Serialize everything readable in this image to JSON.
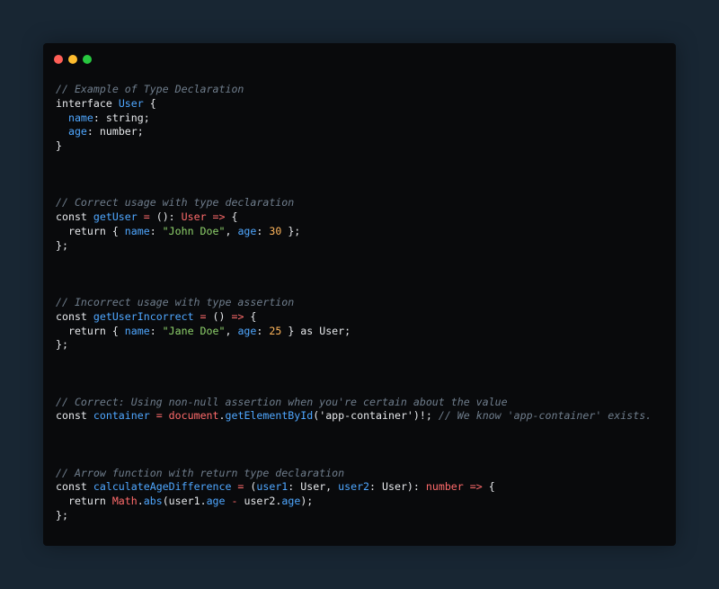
{
  "window": {
    "controls": [
      {
        "name": "close",
        "color": "#ff5f57"
      },
      {
        "name": "minimize",
        "color": "#febc2e"
      },
      {
        "name": "maximize",
        "color": "#28c840"
      }
    ]
  },
  "colors": {
    "page_background": "#182633",
    "editor_background": "#090a0c",
    "comment": "#6f7d8c",
    "type": "#4fa7ff",
    "operator": "#ff6b6b",
    "string": "#8ed16b",
    "number": "#ffb65c",
    "text": "#e6e8eb"
  },
  "code_lines": [
    [
      {
        "t": "// Example of Type Declaration",
        "c": "comment"
      }
    ],
    [
      {
        "t": "interface ",
        "c": "keyword"
      },
      {
        "t": "User",
        "c": "type"
      },
      {
        "t": " {",
        "c": "plain"
      }
    ],
    [
      {
        "t": "  ",
        "c": "plain"
      },
      {
        "t": "name",
        "c": "prop"
      },
      {
        "t": ": string;",
        "c": "plain"
      }
    ],
    [
      {
        "t": "  ",
        "c": "plain"
      },
      {
        "t": "age",
        "c": "prop"
      },
      {
        "t": ": number;",
        "c": "plain"
      }
    ],
    [
      {
        "t": "}",
        "c": "plain"
      }
    ],
    [],
    [],
    [],
    [
      {
        "t": "// Correct usage with type declaration",
        "c": "comment"
      }
    ],
    [
      {
        "t": "const ",
        "c": "keyword"
      },
      {
        "t": "getUser",
        "c": "func"
      },
      {
        "t": " = ",
        "c": "op"
      },
      {
        "t": "(): ",
        "c": "plain"
      },
      {
        "t": "User",
        "c": "op"
      },
      {
        "t": " => ",
        "c": "op"
      },
      {
        "t": "{",
        "c": "plain"
      }
    ],
    [
      {
        "t": "  return { ",
        "c": "plain"
      },
      {
        "t": "name",
        "c": "prop"
      },
      {
        "t": ": ",
        "c": "plain"
      },
      {
        "t": "\"John Doe\"",
        "c": "str"
      },
      {
        "t": ", ",
        "c": "plain"
      },
      {
        "t": "age",
        "c": "prop"
      },
      {
        "t": ": ",
        "c": "plain"
      },
      {
        "t": "30",
        "c": "num"
      },
      {
        "t": " };",
        "c": "plain"
      }
    ],
    [
      {
        "t": "};",
        "c": "plain"
      }
    ],
    [],
    [],
    [],
    [
      {
        "t": "// Incorrect usage with type assertion",
        "c": "comment"
      }
    ],
    [
      {
        "t": "const ",
        "c": "keyword"
      },
      {
        "t": "getUserIncorrect",
        "c": "func"
      },
      {
        "t": " = ",
        "c": "op"
      },
      {
        "t": "() ",
        "c": "plain"
      },
      {
        "t": "=>",
        "c": "op"
      },
      {
        "t": " {",
        "c": "plain"
      }
    ],
    [
      {
        "t": "  return { ",
        "c": "plain"
      },
      {
        "t": "name",
        "c": "prop"
      },
      {
        "t": ": ",
        "c": "plain"
      },
      {
        "t": "\"Jane Doe\"",
        "c": "str"
      },
      {
        "t": ", ",
        "c": "plain"
      },
      {
        "t": "age",
        "c": "prop"
      },
      {
        "t": ": ",
        "c": "plain"
      },
      {
        "t": "25",
        "c": "num"
      },
      {
        "t": " } as User;",
        "c": "plain"
      }
    ],
    [
      {
        "t": "};",
        "c": "plain"
      }
    ],
    [],
    [],
    [],
    [
      {
        "t": "// Correct: Using non-null assertion when you're certain about the value",
        "c": "comment"
      }
    ],
    [
      {
        "t": "const ",
        "c": "keyword"
      },
      {
        "t": "container",
        "c": "func"
      },
      {
        "t": " = ",
        "c": "op"
      },
      {
        "t": "document",
        "c": "op"
      },
      {
        "t": ".",
        "c": "plain"
      },
      {
        "t": "getElementById",
        "c": "func"
      },
      {
        "t": "('app-container')!; ",
        "c": "plain"
      },
      {
        "t": "// We know 'app-container' exists.",
        "c": "comment"
      }
    ],
    [],
    [],
    [],
    [
      {
        "t": "// Arrow function with return type declaration",
        "c": "comment"
      }
    ],
    [
      {
        "t": "const ",
        "c": "keyword"
      },
      {
        "t": "calculateAgeDifference",
        "c": "func"
      },
      {
        "t": " = ",
        "c": "op"
      },
      {
        "t": "(",
        "c": "plain"
      },
      {
        "t": "user1",
        "c": "prop"
      },
      {
        "t": ": User, ",
        "c": "plain"
      },
      {
        "t": "user2",
        "c": "prop"
      },
      {
        "t": ": User): ",
        "c": "plain"
      },
      {
        "t": "number",
        "c": "op"
      },
      {
        "t": " => ",
        "c": "op"
      },
      {
        "t": "{",
        "c": "plain"
      }
    ],
    [
      {
        "t": "  return ",
        "c": "plain"
      },
      {
        "t": "Math",
        "c": "op"
      },
      {
        "t": ".",
        "c": "plain"
      },
      {
        "t": "abs",
        "c": "func"
      },
      {
        "t": "(user1.",
        "c": "plain"
      },
      {
        "t": "age",
        "c": "prop"
      },
      {
        "t": " - ",
        "c": "op"
      },
      {
        "t": "user2.",
        "c": "plain"
      },
      {
        "t": "age",
        "c": "prop"
      },
      {
        "t": ");",
        "c": "plain"
      }
    ],
    [
      {
        "t": "};",
        "c": "plain"
      }
    ]
  ]
}
